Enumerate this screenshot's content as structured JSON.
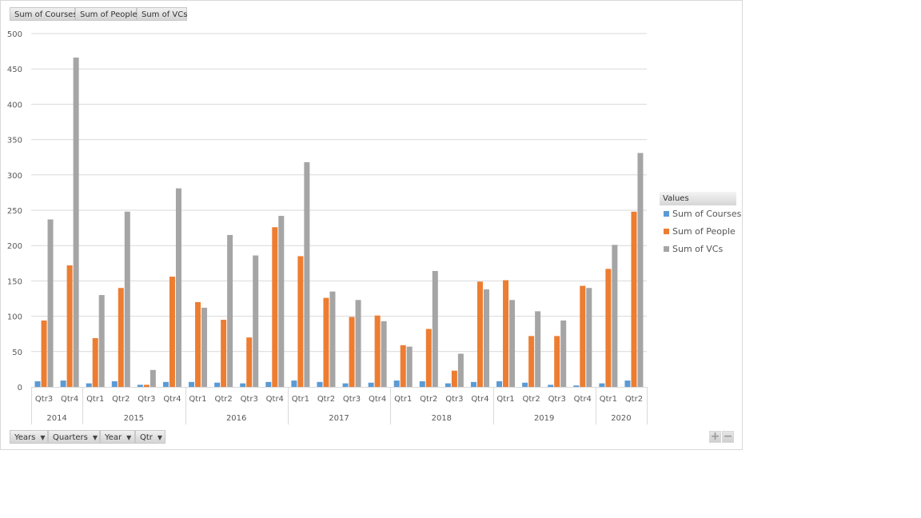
{
  "top_field_buttons": [
    "Sum of Courses",
    "Sum of People",
    "Sum of VCs"
  ],
  "bottom_field_buttons": [
    "Years",
    "Quarters",
    "Year",
    "Qtr"
  ],
  "legend": {
    "title": "Values",
    "items": [
      "Sum of Courses",
      "Sum of People",
      "Sum of VCs"
    ]
  },
  "zoom_controls": {
    "plus": "+",
    "minus": "−"
  },
  "chart_data": {
    "type": "bar",
    "title": "",
    "xlabel": "",
    "ylabel": "",
    "ylim": [
      0,
      500
    ],
    "yticks": [
      0,
      50,
      100,
      150,
      200,
      250,
      300,
      350,
      400,
      450,
      500
    ],
    "grid": true,
    "legend_position": "right",
    "groups": [
      {
        "label": "2014",
        "categories": [
          "Qtr3",
          "Qtr4"
        ]
      },
      {
        "label": "2015",
        "categories": [
          "Qtr1",
          "Qtr2",
          "Qtr3",
          "Qtr4"
        ]
      },
      {
        "label": "2016",
        "categories": [
          "Qtr1",
          "Qtr2",
          "Qtr3",
          "Qtr4"
        ]
      },
      {
        "label": "2017",
        "categories": [
          "Qtr1",
          "Qtr2",
          "Qtr3",
          "Qtr4"
        ]
      },
      {
        "label": "2018",
        "categories": [
          "Qtr1",
          "Qtr2",
          "Qtr3",
          "Qtr4"
        ]
      },
      {
        "label": "2019",
        "categories": [
          "Qtr1",
          "Qtr2",
          "Qtr3",
          "Qtr4"
        ]
      },
      {
        "label": "2020",
        "categories": [
          "Qtr1",
          "Qtr2"
        ]
      }
    ],
    "series": [
      {
        "name": "Sum of Courses",
        "color": "#5b9bd5",
        "values": [
          8,
          9,
          5,
          8,
          3,
          7,
          7,
          6,
          5,
          7,
          9,
          7,
          5,
          6,
          9,
          8,
          5,
          7,
          8,
          6,
          3,
          2,
          5,
          9
        ]
      },
      {
        "name": "Sum of People",
        "color": "#ed7d31",
        "values": [
          94,
          172,
          69,
          140,
          3,
          156,
          120,
          95,
          70,
          226,
          185,
          126,
          99,
          101,
          59,
          82,
          23,
          149,
          151,
          72,
          72,
          143,
          167,
          248
        ]
      },
      {
        "name": "Sum of VCs",
        "color": "#a5a5a5",
        "values": [
          237,
          466,
          130,
          248,
          24,
          281,
          112,
          215,
          186,
          242,
          318,
          135,
          123,
          93,
          57,
          164,
          47,
          138,
          123,
          107,
          94,
          140,
          201,
          331
        ]
      }
    ]
  }
}
